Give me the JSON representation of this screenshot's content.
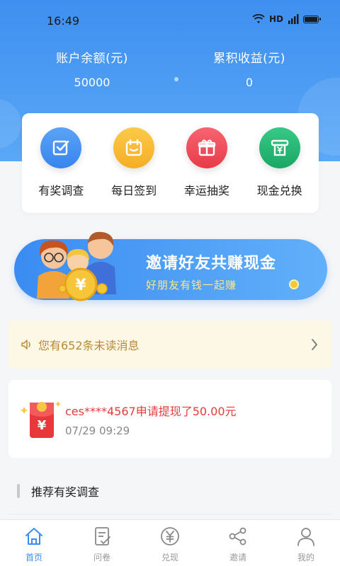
{
  "status_bar": {
    "time": "16:49",
    "network": "HD"
  },
  "account": {
    "balance_label": "账户余额(元)",
    "balance_value": "50000",
    "earnings_label": "累积收益(元)",
    "earnings_value": "0"
  },
  "features": [
    {
      "label": "有奖调查",
      "icon": "survey-check-icon",
      "color": "#3f8ff0"
    },
    {
      "label": "每日签到",
      "icon": "calendar-icon",
      "color": "#f7b72d"
    },
    {
      "label": "幸运抽奖",
      "icon": "gift-icon",
      "color": "#ef4b57"
    },
    {
      "label": "现金兑换",
      "icon": "cash-exchange-icon",
      "color": "#23b373"
    }
  ],
  "banner": {
    "title": "邀请好友共赚现金",
    "subtitle": "好朋友有钱一起赚"
  },
  "notice": {
    "text": "您有652条未读消息"
  },
  "withdraw": {
    "text": "ces****4567申请提现了50.00元",
    "time": "07/29 09:29"
  },
  "section": {
    "title": "推荐有奖调查"
  },
  "tabs": [
    {
      "label": "首页",
      "icon": "home-icon",
      "active": true
    },
    {
      "label": "问卷",
      "icon": "questionnaire-icon",
      "active": false
    },
    {
      "label": "兑现",
      "icon": "yuan-coin-icon",
      "active": false
    },
    {
      "label": "邀请",
      "icon": "share-icon",
      "active": false
    },
    {
      "label": "我的",
      "icon": "user-icon",
      "active": false
    }
  ],
  "colors": {
    "primary": "#3b8ef0",
    "notice_text": "#b98a37",
    "withdraw_text": "#e53b3b"
  }
}
